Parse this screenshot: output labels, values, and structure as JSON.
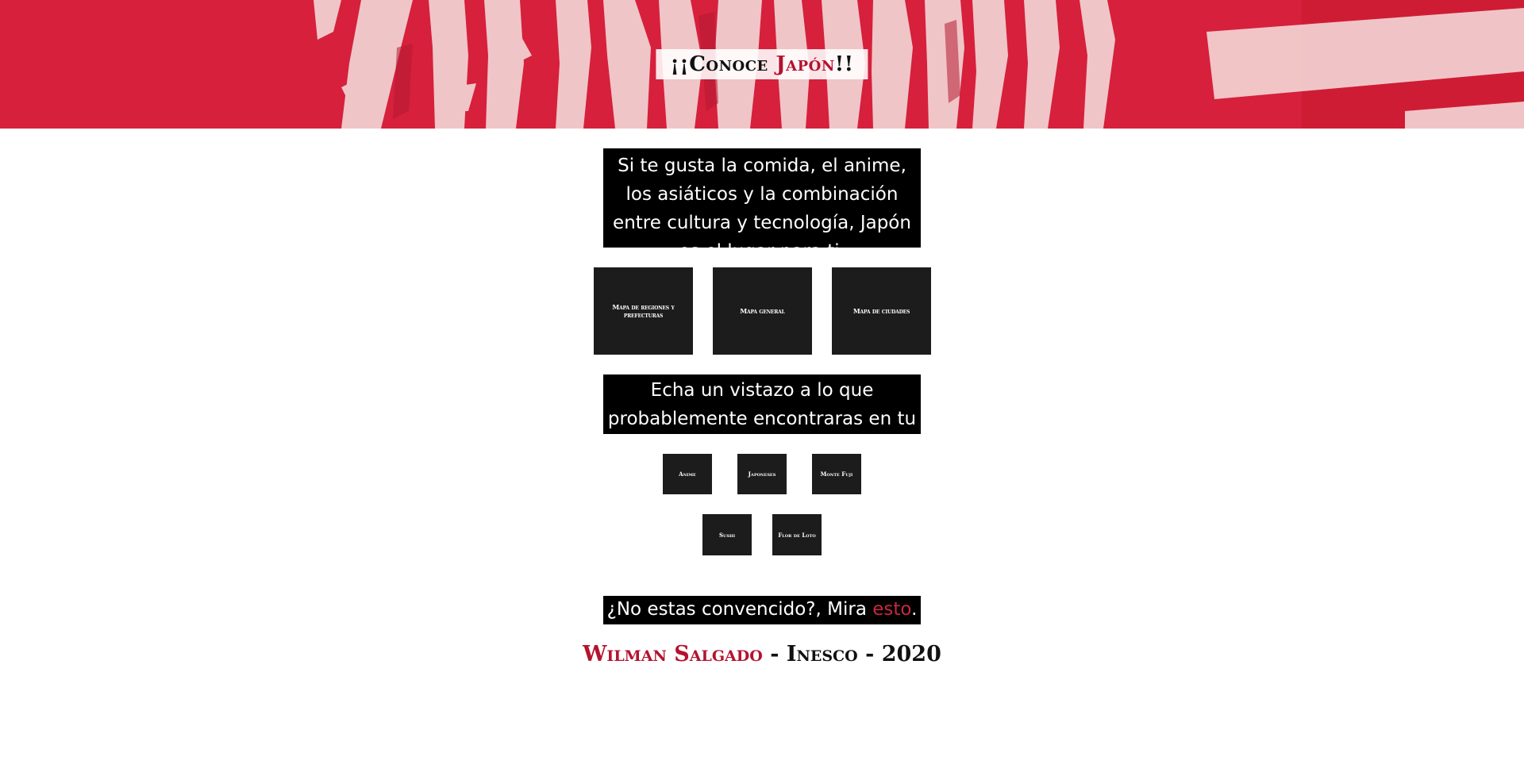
{
  "hero": {
    "title_prefix": "¡¡Conoce ",
    "title_accent": "Japón",
    "title_suffix": "!!",
    "accent_color": "#b5122e",
    "background_color": "#d6203c"
  },
  "intro": {
    "text": "Si te gusta la comida, el anime, los asiáticos y la combinación entre cultura y tecnología, Japón es el lugar para ti."
  },
  "maps": [
    {
      "label": "Mapa de regiones y prefecturas"
    },
    {
      "label": "Mapa general"
    },
    {
      "label": "Mapa de ciudades"
    }
  ],
  "look": {
    "text": "Echa un vistazo a lo que probablemente encontraras en tu viaje."
  },
  "gallery": [
    {
      "label": "Anime"
    },
    {
      "label": "Japoneses"
    },
    {
      "label": "Monte Fuji"
    },
    {
      "label": "Sushi"
    },
    {
      "label": "Flor de Loto"
    }
  ],
  "not_convinced": {
    "prefix": "¿No estas convencido?, Mira ",
    "link": "esto",
    "suffix": ".",
    "link_color": "#c8283e"
  },
  "footer": {
    "author": "Wilman Salgado",
    "separator1": " - ",
    "school": "Inesco",
    "separator2": " - ",
    "year": "2020"
  }
}
